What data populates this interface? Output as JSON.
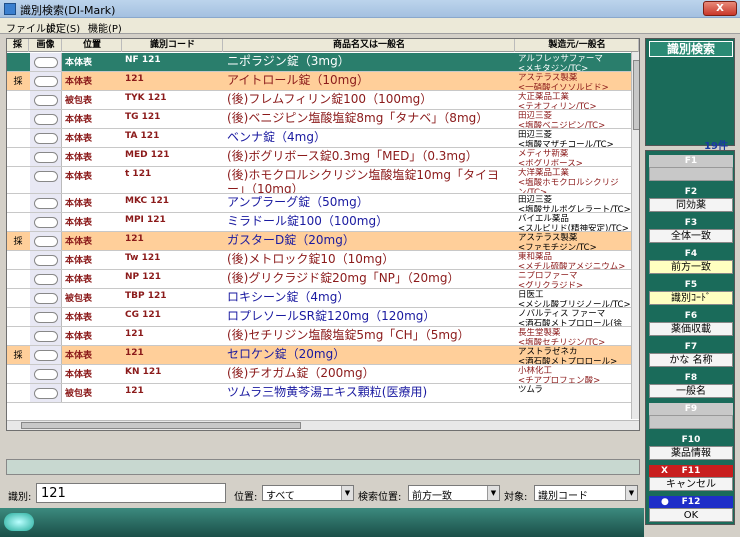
{
  "window": {
    "title": "識別検索(DI-Mark)",
    "close": "X"
  },
  "menu": [
    "ファイル(F)",
    "設定(S)",
    "機能(P)"
  ],
  "columns": [
    "採",
    "画像",
    "位置",
    "識別コード",
    "商品名又は一般名",
    "製造元/一般名"
  ],
  "rows": [
    {
      "sai": "",
      "pos": "本体表",
      "code": "NF 121",
      "name": "ニポラジン錠（3mg）",
      "mfr1": "アルフレッサファーマ",
      "mfr2": "<メキタジン/TC>",
      "name_color": "#1a1aa0",
      "mfr_color": "#000",
      "bg": "#2a7e6c",
      "name_light": true
    },
    {
      "sai": "採",
      "pos": "本体表",
      "code": "121",
      "name": "アイトロール錠（10mg）",
      "mfr1": "アステラス製薬",
      "mfr2": "<一硝酸イソソルビド>",
      "name_color": "#8b1a1a",
      "mfr_color": "#8b1a1a",
      "bg": "#ffcf9a"
    },
    {
      "sai": "",
      "pos": "被包表",
      "code": "TYK 121",
      "name": "(後)フレムフィリン錠100（100mg）",
      "mfr1": "大正薬品工業",
      "mfr2": "<テオフィリン/TC>",
      "name_color": "#8b1a1a",
      "mfr_color": "#8b1a1a",
      "bg": "#fff"
    },
    {
      "sai": "",
      "pos": "本体表",
      "code": "TG 121",
      "name": "(後)ベニジピン塩酸塩錠8mg「タナベ」（8mg）",
      "mfr1": "田辺三菱",
      "mfr2": "<塩酸ベニジピン/TC>",
      "name_color": "#8b1a1a",
      "mfr_color": "#8b1a1a",
      "bg": "#fff"
    },
    {
      "sai": "",
      "pos": "本体表",
      "code": "TA 121",
      "name": "ベンナ錠（4mg）",
      "mfr1": "田辺三菱",
      "mfr2": "<塩酸マザチコール/TC>",
      "name_color": "#1a1aa0",
      "mfr_color": "#000",
      "bg": "#fff"
    },
    {
      "sai": "",
      "pos": "本体表",
      "code": "MED 121",
      "name": "(後)ボグリボース錠0.3mg「MED」（0.3mg）",
      "mfr1": "メディサ新薬",
      "mfr2": "<ボグリボース>",
      "name_color": "#8b1a1a",
      "mfr_color": "#8b1a1a",
      "bg": "#fff"
    },
    {
      "sai": "",
      "pos": "本体表",
      "code": "t 121",
      "name": "(後)ホモクロルシクリジン塩酸塩錠10mg「タイヨー」（10mg）",
      "mfr1": "大洋薬品工業",
      "mfr2": "<塩酸ホモクロルシクリジン/TC>",
      "name_color": "#8b1a1a",
      "mfr_color": "#8b1a1a",
      "bg": "#fff",
      "tall": true
    },
    {
      "sai": "",
      "pos": "本体表",
      "code": "MKC 121",
      "name": "アンプラーグ錠（50mg）",
      "mfr1": "田辺三菱",
      "mfr2": "<塩酸サルポグレラート/TC>",
      "name_color": "#1a1aa0",
      "mfr_color": "#000",
      "bg": "#fff"
    },
    {
      "sai": "",
      "pos": "本体表",
      "code": "MPI 121",
      "name": "ミラドール錠100（100mg）",
      "mfr1": "バイエル薬品",
      "mfr2": "<スルピリド(精神安定)/TC>",
      "name_color": "#1a1aa0",
      "mfr_color": "#000",
      "bg": "#fff"
    },
    {
      "sai": "採",
      "pos": "本体表",
      "code": "121",
      "name": "ガスターD錠（20mg）",
      "mfr1": "アステラス製薬",
      "mfr2": "<ファモチジン/TC>",
      "name_color": "#1a1aa0",
      "mfr_color": "#000",
      "bg": "#ffcf9a"
    },
    {
      "sai": "",
      "pos": "本体表",
      "code": "Tw 121",
      "name": "(後)メトロック錠10（10mg）",
      "mfr1": "東和薬品",
      "mfr2": "<メチル硫酸アメジニウム>",
      "name_color": "#8b1a1a",
      "mfr_color": "#8b1a1a",
      "bg": "#fff"
    },
    {
      "sai": "",
      "pos": "本体表",
      "code": "NP 121",
      "name": "(後)グリクラジド錠20mg「NP」（20mg）",
      "mfr1": "ニプロファーマ",
      "mfr2": "<グリクラジド>",
      "name_color": "#8b1a1a",
      "mfr_color": "#8b1a1a",
      "bg": "#fff"
    },
    {
      "sai": "",
      "pos": "被包表",
      "code": "TBP 121",
      "name": "ロキシーン錠（4mg）",
      "mfr1": "日医工",
      "mfr2": "<メシル酸ブリジノール/TC>",
      "name_color": "#1a1aa0",
      "mfr_color": "#000",
      "bg": "#fff"
    },
    {
      "sai": "",
      "pos": "本体表",
      "code": "CG 121",
      "name": "ロプレソールSR錠120mg（120mg）",
      "mfr1": "ノバルティス ファーマ",
      "mfr2": "<酒石酸メトプロロール(徐放)>",
      "name_color": "#1a1aa0",
      "mfr_color": "#000",
      "bg": "#fff"
    },
    {
      "sai": "",
      "pos": "本体表",
      "code": "121",
      "name": "(後)セチリジン塩酸塩錠5mg「CH」（5mg）",
      "mfr1": "長生堂製薬",
      "mfr2": "<塩酸セチリジン/TC>",
      "name_color": "#8b1a1a",
      "mfr_color": "#8b1a1a",
      "bg": "#fff"
    },
    {
      "sai": "採",
      "pos": "本体表",
      "code": "121",
      "name": "セロケン錠（20mg）",
      "mfr1": "アストラゼネカ",
      "mfr2": "<酒石酸メトプロロール>",
      "name_color": "#1a1aa0",
      "mfr_color": "#000",
      "bg": "#ffcf9a"
    },
    {
      "sai": "",
      "pos": "本体表",
      "code": "KN 121",
      "name": "(後)チオガム錠（200mg）",
      "mfr1": "小林化工",
      "mfr2": "<チアプロフェン酸>",
      "name_color": "#8b1a1a",
      "mfr_color": "#8b1a1a",
      "bg": "#fff"
    },
    {
      "sai": "",
      "pos": "被包表",
      "code": "121",
      "name": "ツムラ三物黄芩湯エキス顆粒(医療用)",
      "mfr1": "ツムラ",
      "mfr2": "",
      "name_color": "#1a1aa0",
      "mfr_color": "#000",
      "bg": "#fff"
    }
  ],
  "panel": {
    "title": "識別検索",
    "count": "19件"
  },
  "fkeys": [
    {
      "key": "F1",
      "label": "",
      "disabled": true
    },
    {
      "key": "F2",
      "label": "同効薬"
    },
    {
      "key": "F3",
      "label": "全体一致"
    },
    {
      "key": "F4",
      "label": "前方一致",
      "active": true
    },
    {
      "key": "F5",
      "label": "識別ｺｰﾄﾞ",
      "active": true
    },
    {
      "key": "F6",
      "label": "薬価収載"
    },
    {
      "key": "F7",
      "label": "かな 名称"
    },
    {
      "key": "F8",
      "label": "一般名"
    },
    {
      "key": "F9",
      "label": "",
      "disabled": true
    },
    {
      "key": "F10",
      "label": "薬品情報"
    },
    {
      "key": "F11",
      "label": "キャンセル",
      "mark": "X",
      "red": true
    },
    {
      "key": "F12",
      "label": "OK",
      "mark": "●",
      "blue": true
    }
  ],
  "search": {
    "id_label": "識別:",
    "id_value": "121",
    "pos_label": "位置:",
    "pos_value": "すべて",
    "mode_label": "検索位置:",
    "mode_value": "前方一致",
    "target_label": "対象:",
    "target_value": "識別コード"
  }
}
